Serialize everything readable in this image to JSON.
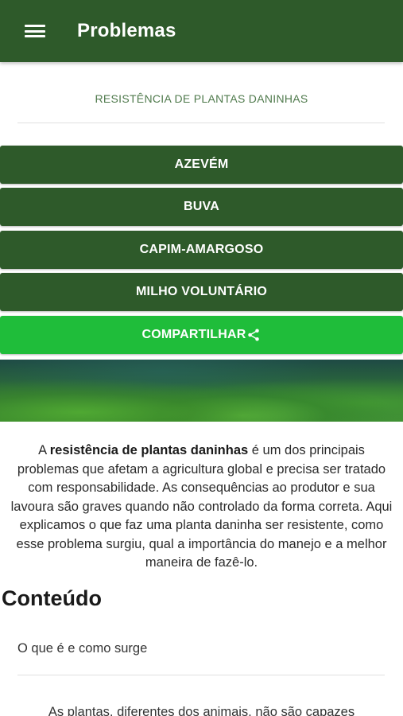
{
  "app_bar": {
    "title": "Problemas",
    "menu_icon": "hamburger-menu-icon"
  },
  "subtitle": "RESISTÊNCIA DE PLANTAS DANINHAS",
  "buttons": [
    {
      "label": "AZEVÉM"
    },
    {
      "label": "BUVA"
    },
    {
      "label": "CAPIM-AMARGOSO"
    },
    {
      "label": "MILHO VOLUNTÁRIO"
    }
  ],
  "share_button": {
    "label": "COMPARTILHAR",
    "icon": "share-icon"
  },
  "intro": {
    "prefix": "A ",
    "bold": "resistência de plantas daninhas",
    "rest": " é um dos principais problemas que afetam a agricultura global e precisa ser tratado com responsabilidade. As consequências ao produtor e sua lavoura são graves quando não controlado da forma correta. Aqui explicamos o que faz uma planta daninha ser resistente, como esse problema surgiu, qual a importância do manejo e a melhor maneira de fazê-lo."
  },
  "contents": {
    "heading": "Conteúdo",
    "items": [
      {
        "label": "O que é e como surge"
      }
    ]
  },
  "partial_text": "As plantas, diferentes dos animais, não são capazes",
  "colors": {
    "primary": "#2e5a2a",
    "share": "#1fbd3a",
    "subtitle": "#4f7a4c"
  }
}
